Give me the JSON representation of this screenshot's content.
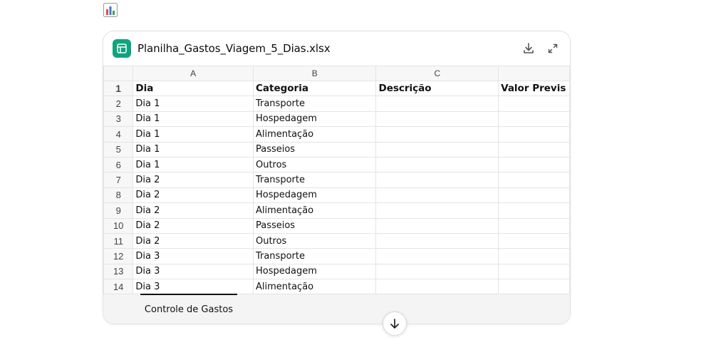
{
  "file": {
    "name": "Planilha_Gastos_Viagem_5_Dias.xlsx"
  },
  "icons": {
    "chart_emoji": "bar-chart-emoji-icon",
    "file": "spreadsheet-icon",
    "download": "download-icon",
    "expand": "expand-icon",
    "scroll": "arrow-down-icon"
  },
  "colors": {
    "file_icon": "#10a37f",
    "accent": "#111111"
  },
  "sheet": {
    "columns": [
      "A",
      "B",
      "C",
      ""
    ],
    "header": [
      "Dia",
      "Categoria",
      "Descrição",
      "Valor Previs"
    ],
    "rows": [
      {
        "num": "1"
      },
      {
        "num": "2",
        "dia": "Dia 1",
        "categoria": "Transporte"
      },
      {
        "num": "3",
        "dia": "Dia 1",
        "categoria": "Hospedagem"
      },
      {
        "num": "4",
        "dia": "Dia 1",
        "categoria": "Alimentação"
      },
      {
        "num": "5",
        "dia": "Dia 1",
        "categoria": "Passeios"
      },
      {
        "num": "6",
        "dia": "Dia 1",
        "categoria": "Outros"
      },
      {
        "num": "7",
        "dia": "Dia 2",
        "categoria": "Transporte"
      },
      {
        "num": "8",
        "dia": "Dia 2",
        "categoria": "Hospedagem"
      },
      {
        "num": "9",
        "dia": "Dia 2",
        "categoria": "Alimentação"
      },
      {
        "num": "10",
        "dia": "Dia 2",
        "categoria": "Passeios"
      },
      {
        "num": "11",
        "dia": "Dia 2",
        "categoria": "Outros"
      },
      {
        "num": "12",
        "dia": "Dia 3",
        "categoria": "Transporte"
      },
      {
        "num": "13",
        "dia": "Dia 3",
        "categoria": "Hospedagem"
      },
      {
        "num": "14",
        "dia": "Dia 3",
        "categoria": "Alimentação"
      }
    ]
  },
  "tabs": [
    {
      "label": "Controle de Gastos",
      "active": true
    }
  ]
}
